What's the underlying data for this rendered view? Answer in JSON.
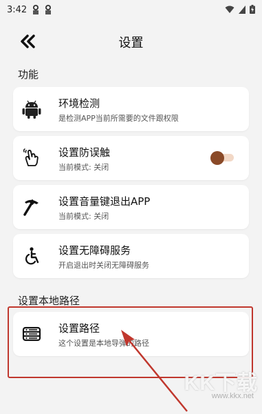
{
  "status_bar": {
    "time": "3:42"
  },
  "app_bar": {
    "title": "设置"
  },
  "sections": {
    "functions_title": "功能",
    "local_path_title": "设置本地路径"
  },
  "items": [
    {
      "title": "环境检测",
      "subtitle": "是检测APP当前所需要的文件跟权限",
      "icon": "android-icon"
    },
    {
      "title": "设置防误触",
      "subtitle": "当前模式: 关闭",
      "icon": "touch-hand-icon",
      "toggle_on": false
    },
    {
      "title": "设置音量键退出APP",
      "subtitle": "当前模式: 关闭",
      "icon": "pickaxe-icon"
    },
    {
      "title": "设置无障碍服务",
      "subtitle": "开启退出时关闭无障碍服务",
      "icon": "accessibility-icon"
    },
    {
      "title": "设置路径",
      "subtitle": "这个设置是本地导弹的路径",
      "icon": "storage-icon"
    }
  ],
  "watermark": {
    "main": "KK下载",
    "url": "www.kkx.net"
  },
  "colors": {
    "accent": "#8a4a28",
    "highlight": "#c0372d"
  }
}
